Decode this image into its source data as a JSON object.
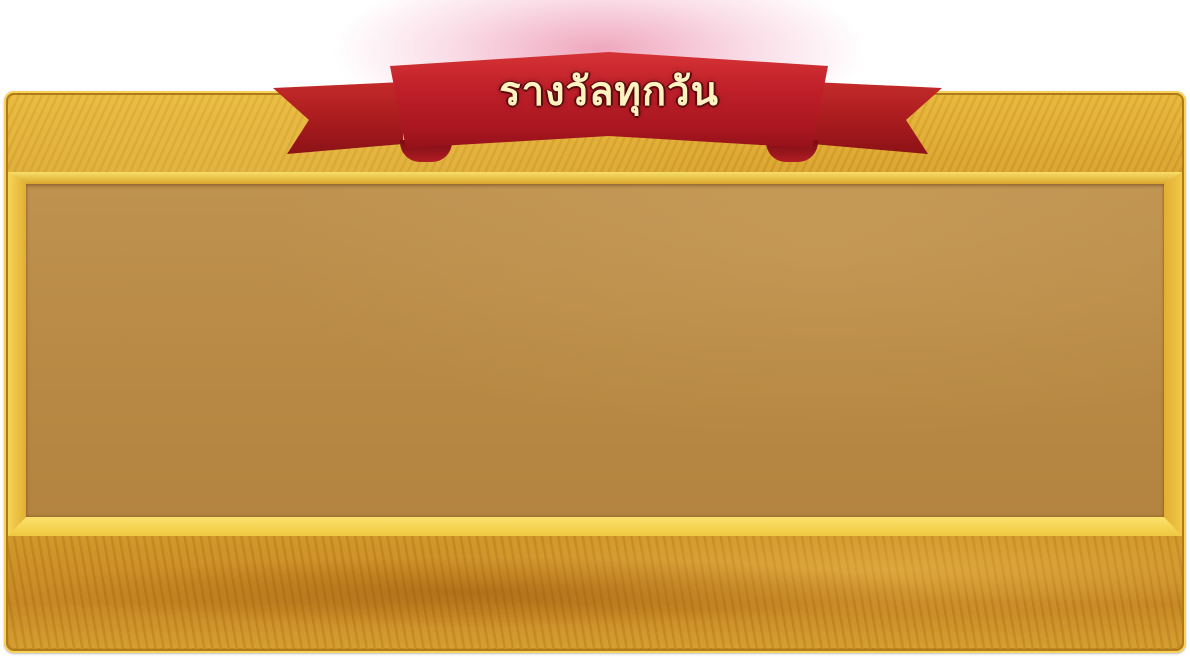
{
  "banner": {
    "title": "รางวัลทุกวัน"
  },
  "content_panel": {
    "items": []
  },
  "colors": {
    "ribbon": "#b11d24",
    "frame_gold": "#d9a22c",
    "panel_brown": "#b88a45",
    "title_text": "#fff3c2"
  }
}
